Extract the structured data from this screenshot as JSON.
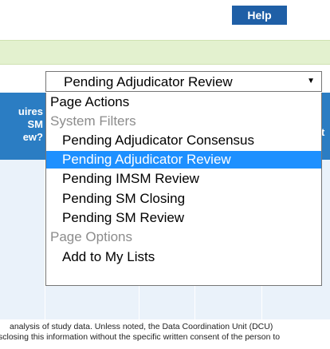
{
  "header": {
    "help_label": "Help"
  },
  "table": {
    "header_left": [
      "uires",
      "SM",
      "ew?"
    ],
    "header_right": [
      "t"
    ]
  },
  "filter_select": {
    "value": "Pending Adjudicator Review",
    "arrow": "▼",
    "options": [
      {
        "label": "Page Actions",
        "kind": "action"
      },
      {
        "label": "System Filters",
        "kind": "group"
      },
      {
        "label": "Pending Adjudicator Consensus",
        "kind": "item"
      },
      {
        "label": "Pending Adjudicator Review",
        "kind": "item",
        "selected": true
      },
      {
        "label": "Pending IMSM Review",
        "kind": "item"
      },
      {
        "label": "Pending SM Closing",
        "kind": "item"
      },
      {
        "label": "Pending SM Review",
        "kind": "item"
      },
      {
        "label": "Page Options",
        "kind": "group"
      },
      {
        "label": "Add to My Lists",
        "kind": "item"
      }
    ]
  },
  "footer": {
    "line1": "analysis of study data. Unless noted, the Data Coordination Unit (DCU)",
    "line2": "sclosing this information without the specific written consent of the person to"
  },
  "colors": {
    "help_button": "#1f5fa6",
    "header_blue": "#2b7dc3",
    "row_bg": "#eaf2fa",
    "green_bar": "#e3f1cf",
    "selected_option": "#1e90ff"
  }
}
